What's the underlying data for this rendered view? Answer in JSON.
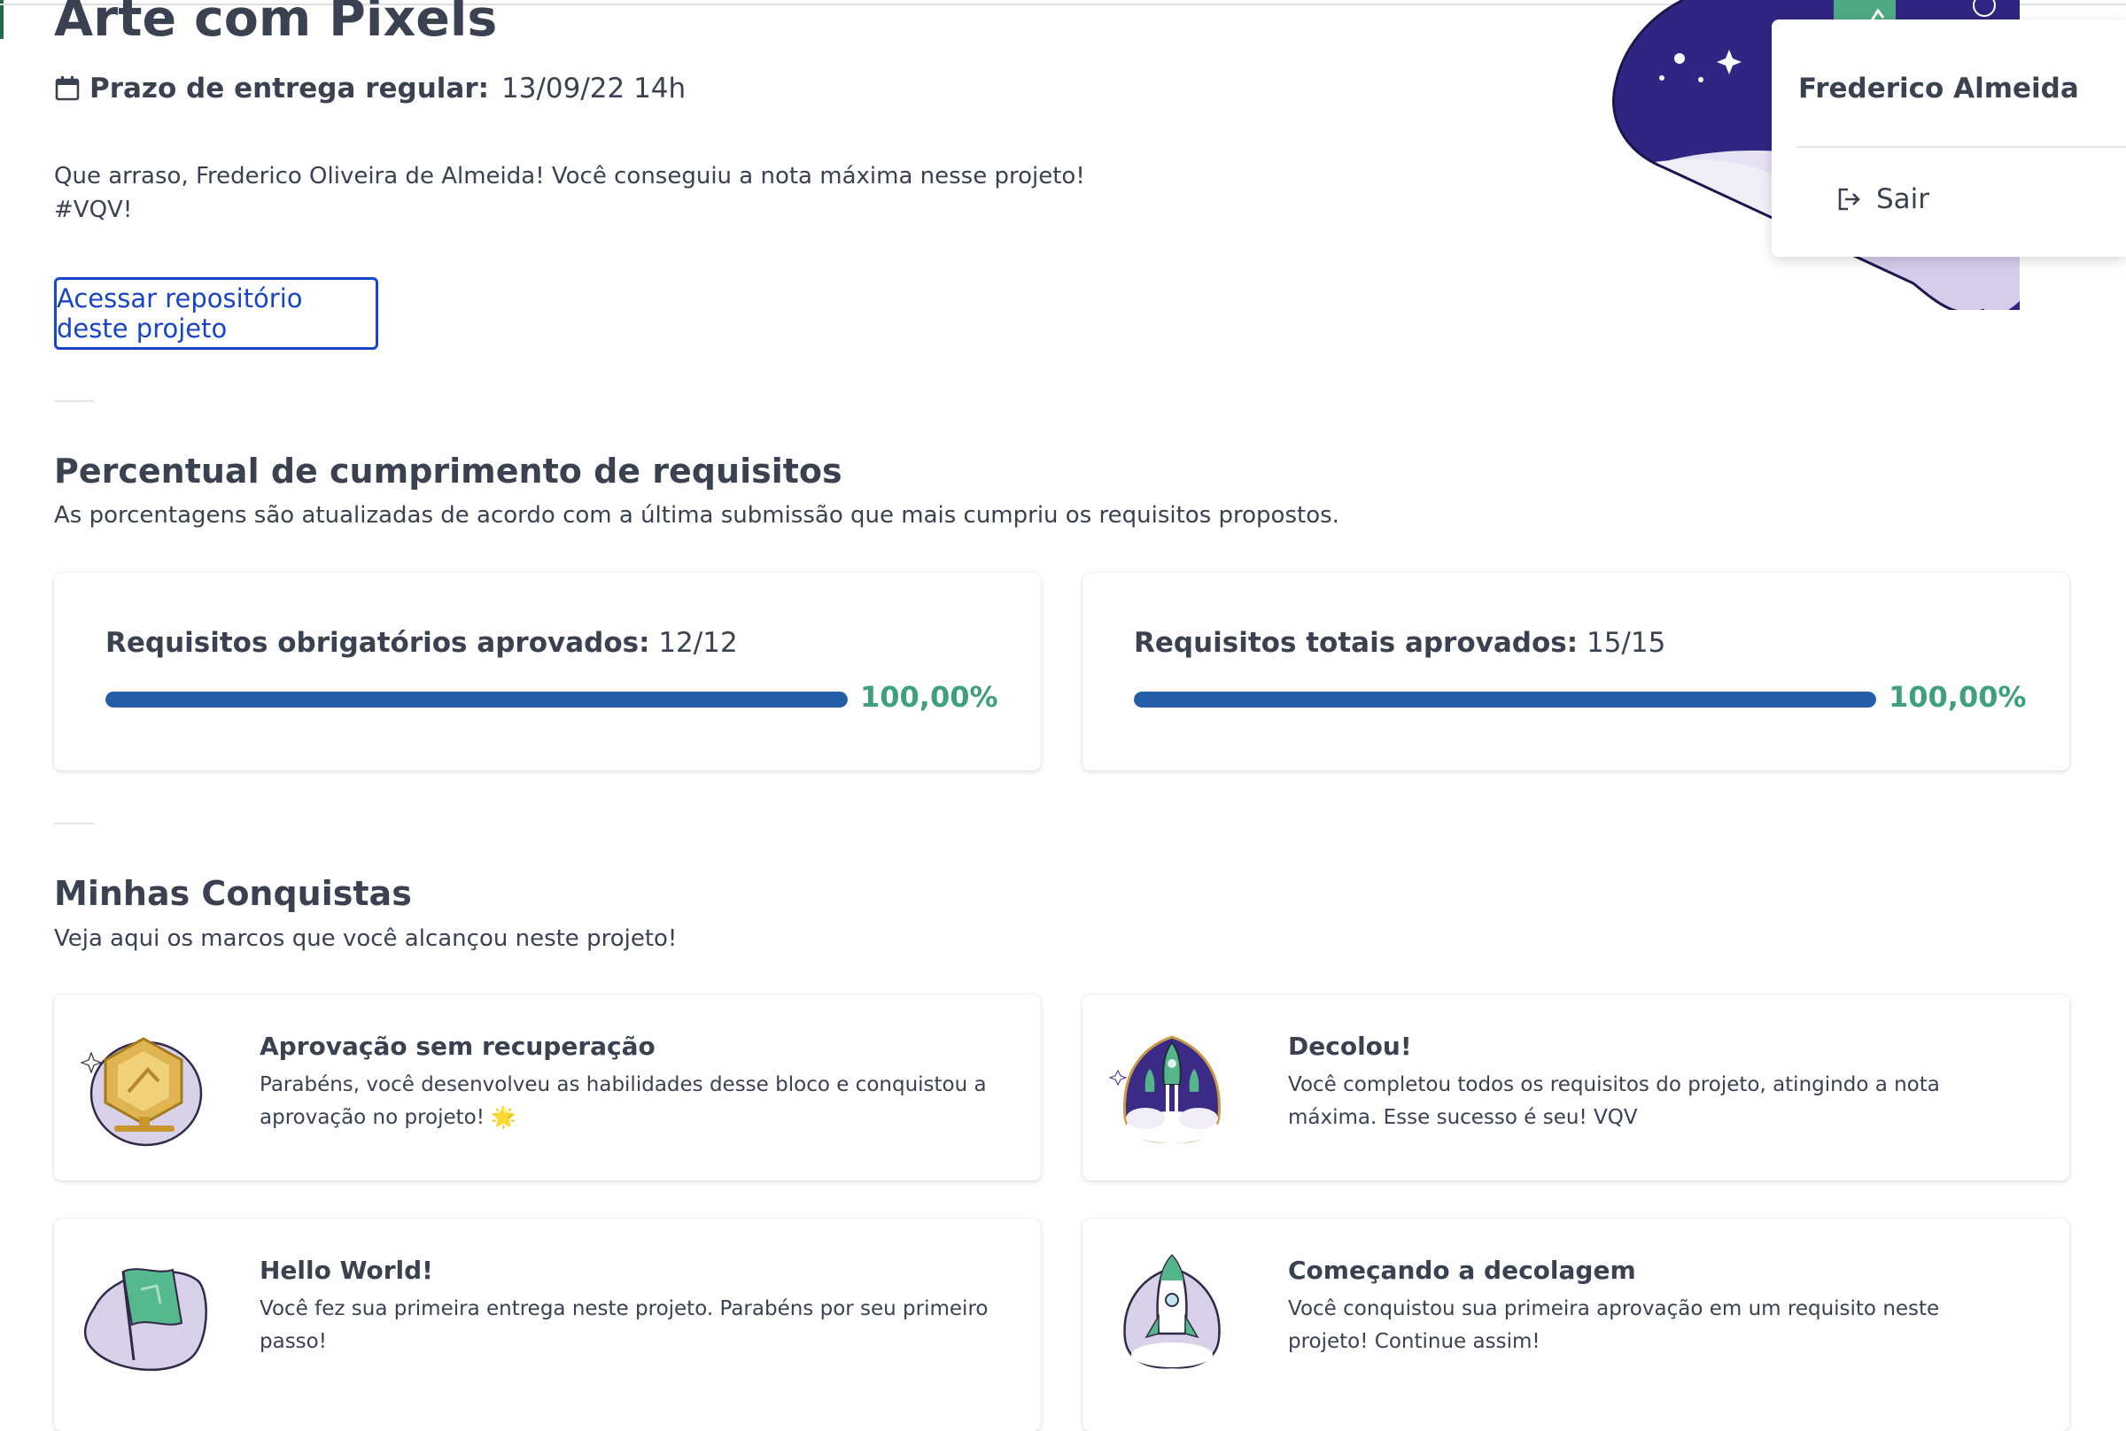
{
  "project": {
    "title": "Arte com Pixels",
    "deadline_label": "Prazo de entrega regular:",
    "deadline_value": "13/09/22 14h",
    "message_line1": "Que arraso, Frederico Oliveira de Almeida! Você conseguiu a nota máxima nesse projeto!",
    "message_line2": "#VQV!",
    "repo_button": "Acessar repositório deste projeto"
  },
  "requirements": {
    "title": "Percentual de cumprimento de requisitos",
    "subtitle": "As porcentagens são atualizadas de acordo com a última submissão que mais cumpriu os requisitos propostos.",
    "mandatory": {
      "label": "Requisitos obrigatórios aprovados:",
      "value": "12/12",
      "percent_text": "100,00%",
      "progress": 1.0
    },
    "total": {
      "label": "Requisitos totais aprovados:",
      "value": "15/15",
      "percent_text": "100,00%",
      "progress": 1.0
    }
  },
  "achievements": {
    "title": "Minhas Conquistas",
    "subtitle": "Veja aqui os marcos que você alcançou neste projeto!",
    "items": [
      {
        "title": "Aprovação sem recuperação",
        "description": "Parabéns, você desenvolveu as habilidades desse bloco e conquistou a aprovação no projeto! 🌟",
        "icon": "gold-medal-icon"
      },
      {
        "title": "Decolou!",
        "description": "Você completou todos os requisitos do projeto, atingindo a nota máxima. Esse sucesso é seu! VQV",
        "icon": "rockets-launch-icon"
      },
      {
        "title": "Hello World!",
        "description": "Você fez sua primeira entrega neste projeto. Parabéns por seu primeiro passo!",
        "icon": "green-flag-icon"
      },
      {
        "title": "Começando a decolagem",
        "description": "Você conquistou sua primeira aprovação em um requisito neste projeto! Continue assim!",
        "icon": "rocket-icon"
      }
    ]
  },
  "user_menu": {
    "name": "Frederico Almeida",
    "logout_label": "Sair"
  },
  "colors": {
    "text": "#3a4150",
    "link": "#1844c8",
    "progress_bar": "#245ea8",
    "percent_text": "#3fa07e",
    "hero_purple": "#2f2683"
  }
}
